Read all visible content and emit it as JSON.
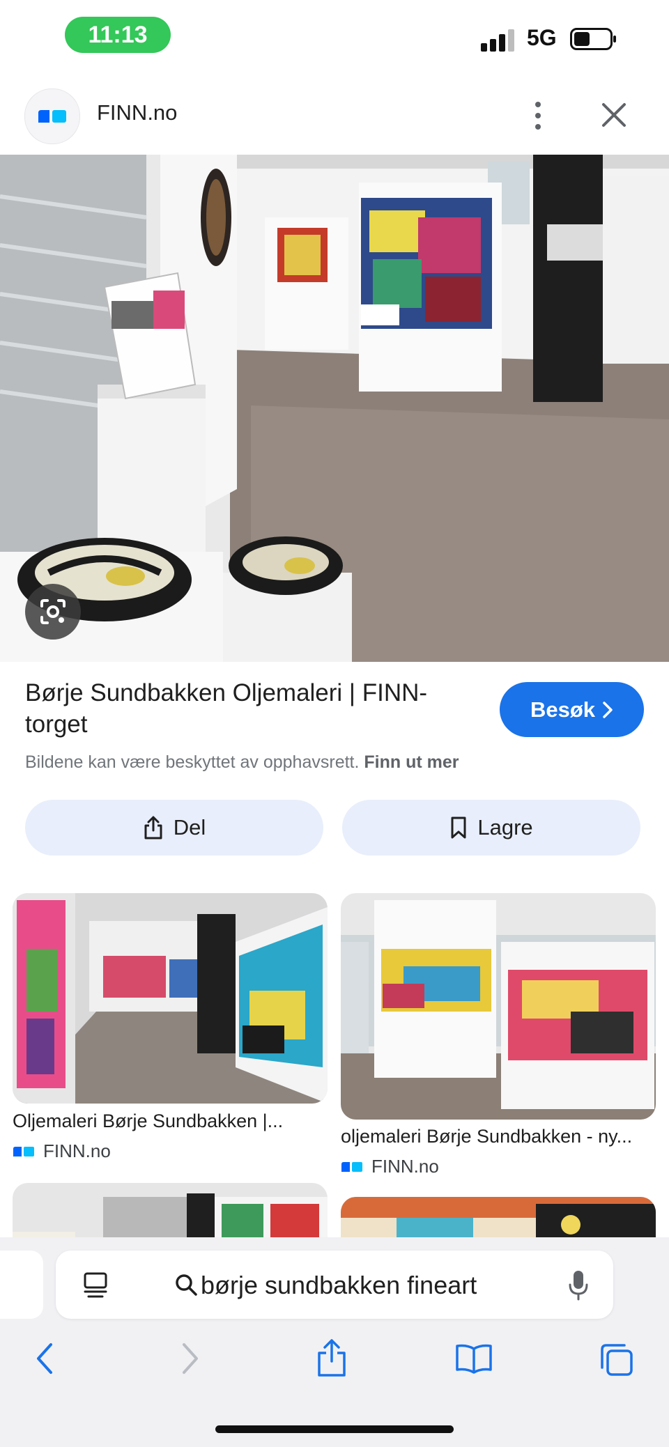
{
  "status_bar": {
    "time": "11:13",
    "network": "5G",
    "battery_fill": 0.45
  },
  "header": {
    "site_name": "FINN.no"
  },
  "result": {
    "title": "Børje Sundbakken Oljemaleri | FINN-torget",
    "visit_label": "Besøk",
    "copyright_notice": "Bildene kan være beskyttet av opphavsrett.",
    "learn_more": "Finn ut mer",
    "share_label": "Del",
    "save_label": "Lagre"
  },
  "related": [
    {
      "caption": "Oljemaleri Børje Sundbakken |...",
      "source": "FINN.no"
    },
    {
      "caption": "oljemaleri Børje Sundbakken - ny...",
      "source": "FINN.no"
    }
  ],
  "search": {
    "query": "børje sundbakken fineart"
  },
  "icons": {
    "site_logo": "finn-logo-icon",
    "menu": "more-vert-icon",
    "close": "close-icon",
    "lens": "google-lens-icon",
    "share": "share-icon",
    "save": "bookmark-icon",
    "tabs": "tab-list-icon",
    "search": "search-icon",
    "mic": "mic-icon",
    "back": "back-arrow-icon",
    "forward": "forward-arrow-icon",
    "toolbar_share": "share-icon",
    "bookmarks": "bookmarks-icon",
    "tab_switcher": "tabs-icon"
  },
  "colors": {
    "accent": "#1a73e8",
    "pill_bg": "#e8eefb",
    "status_green": "#34c759",
    "finn_blue": "#0063fb"
  }
}
